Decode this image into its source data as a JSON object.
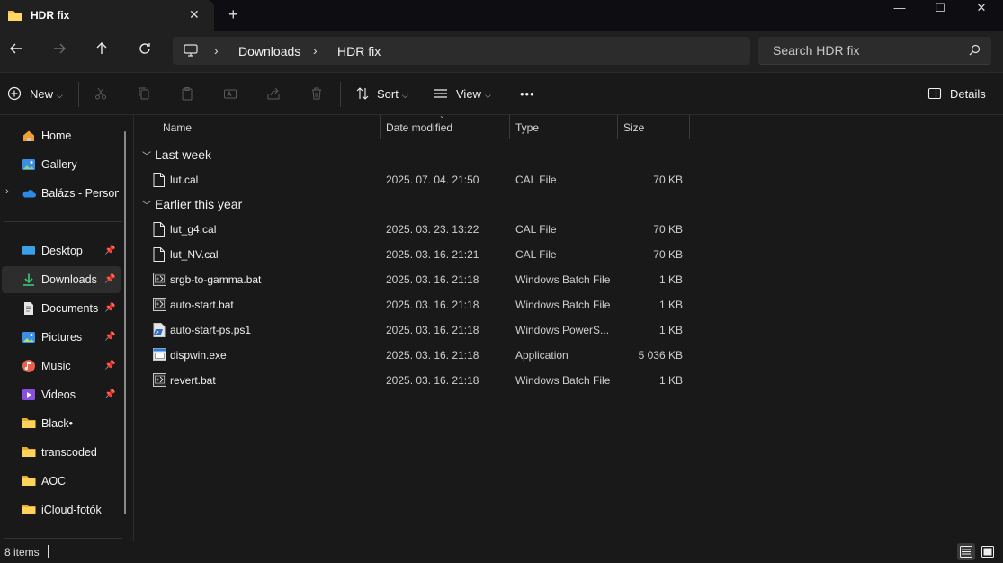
{
  "window": {
    "tab_title": "HDR fix",
    "tab_close": "✕",
    "new_tab": "+",
    "minimize": "—",
    "maximize": "☐",
    "close": "✕"
  },
  "nav": {
    "breadcrumb": [
      "Downloads",
      "HDR fix"
    ],
    "search_placeholder": "Search HDR fix"
  },
  "toolbar": {
    "new_label": "New",
    "sort_label": "Sort",
    "view_label": "View",
    "more_label": "•••",
    "details_label": "Details"
  },
  "sidebar": {
    "top": [
      {
        "label": "Home",
        "icon": "home-icon"
      },
      {
        "label": "Gallery",
        "icon": "gallery-icon"
      },
      {
        "label": "Balázs - Personal",
        "icon": "onedrive-icon"
      }
    ],
    "pinned": [
      {
        "label": "Desktop",
        "icon": "desktop-icon",
        "pinned": true
      },
      {
        "label": "Downloads",
        "icon": "download-icon",
        "pinned": true,
        "selected": true
      },
      {
        "label": "Documents",
        "icon": "documents-icon",
        "pinned": true
      },
      {
        "label": "Pictures",
        "icon": "pictures-icon",
        "pinned": true
      },
      {
        "label": "Music",
        "icon": "music-icon",
        "pinned": true
      },
      {
        "label": "Videos",
        "icon": "videos-icon",
        "pinned": true
      },
      {
        "label": "Black•",
        "icon": "folder-icon"
      },
      {
        "label": "transcoded",
        "icon": "folder-icon"
      },
      {
        "label": "AOC",
        "icon": "folder-icon"
      },
      {
        "label": "iCloud-fotók",
        "icon": "folder-icon"
      }
    ]
  },
  "columns": {
    "name": "Name",
    "date": "Date modified",
    "type": "Type",
    "size": "Size"
  },
  "groups": [
    {
      "label": "Last week",
      "files": [
        {
          "name": "lut.cal",
          "date": "2025. 07. 04. 21:50",
          "type": "CAL File",
          "size": "70 KB",
          "icon": "file-icon"
        }
      ]
    },
    {
      "label": "Earlier this year",
      "files": [
        {
          "name": "lut_g4.cal",
          "date": "2025. 03. 23. 13:22",
          "type": "CAL File",
          "size": "70 KB",
          "icon": "file-icon"
        },
        {
          "name": "lut_NV.cal",
          "date": "2025. 03. 16. 21:21",
          "type": "CAL File",
          "size": "70 KB",
          "icon": "file-icon"
        },
        {
          "name": "srgb-to-gamma.bat",
          "date": "2025. 03. 16. 21:18",
          "type": "Windows Batch File",
          "size": "1 KB",
          "icon": "batch-file-icon"
        },
        {
          "name": "auto-start.bat",
          "date": "2025. 03. 16. 21:18",
          "type": "Windows Batch File",
          "size": "1 KB",
          "icon": "batch-file-icon"
        },
        {
          "name": "auto-start-ps.ps1",
          "date": "2025. 03. 16. 21:18",
          "type": "Windows PowerS...",
          "size": "1 KB",
          "icon": "powershell-file-icon"
        },
        {
          "name": "dispwin.exe",
          "date": "2025. 03. 16. 21:18",
          "type": "Application",
          "size": "5 036 KB",
          "icon": "application-icon"
        },
        {
          "name": "revert.bat",
          "date": "2025. 03. 16. 21:18",
          "type": "Windows Batch File",
          "size": "1 KB",
          "icon": "batch-file-icon"
        }
      ]
    }
  ],
  "status": {
    "item_count": "8 items"
  },
  "colors": {
    "accent": "#4cc2ff",
    "folder": "#f6c343",
    "background": "#191919"
  }
}
